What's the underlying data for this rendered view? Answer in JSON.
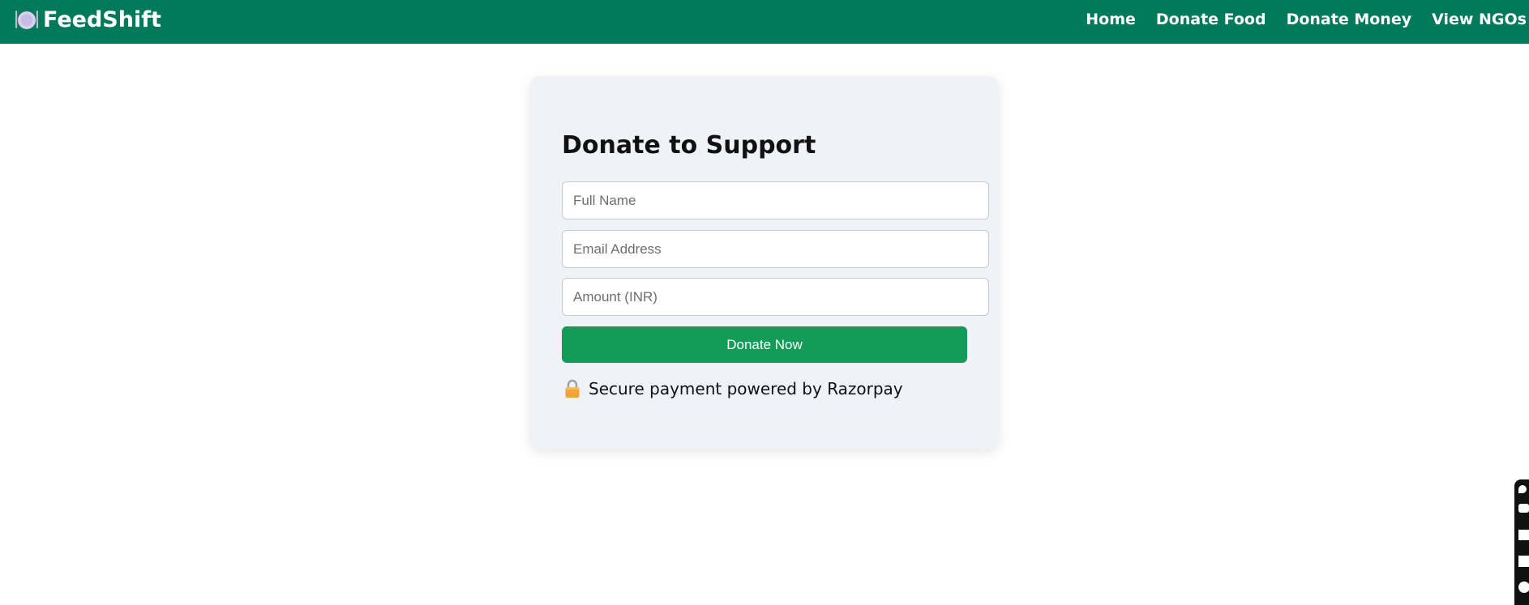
{
  "brand": {
    "name": "FeedShift",
    "icon": "plate-cutlery-icon"
  },
  "nav": {
    "items": [
      {
        "label": "Home"
      },
      {
        "label": "Donate Food"
      },
      {
        "label": "Donate Money"
      },
      {
        "label": "View NGOs"
      }
    ]
  },
  "form": {
    "title": "Donate to Support",
    "name_placeholder": "Full Name",
    "email_placeholder": "Email Address",
    "amount_placeholder": "Amount (INR)",
    "submit_label": "Donate Now",
    "secure_text": "Secure payment powered by Razorpay",
    "secure_icon": "lock-icon"
  },
  "toolbar": {
    "icons": [
      "rocket-icon",
      "camera-icon",
      "square-icon",
      "copy-icon",
      "gear-icon"
    ]
  },
  "colors": {
    "navbar": "#017a5b",
    "card_bg": "#eff3f8",
    "button": "#139c58"
  }
}
